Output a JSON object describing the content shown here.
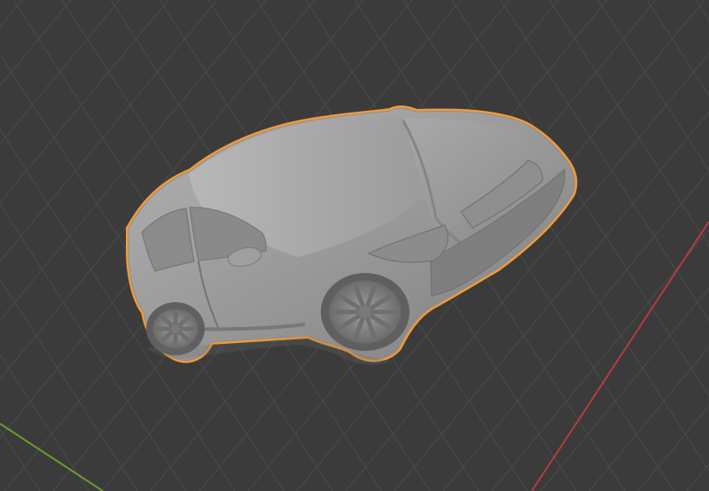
{
  "viewport": {
    "background_color": "#3b3b3b",
    "grid_color": "#4b4b4b",
    "x_axis_color": "#b53b43",
    "y_axis_color": "#6a9a2f",
    "selection_outline_color": "#f29a38"
  },
  "scene": {
    "object": "car-3d-model",
    "shading": "solid",
    "selected": true
  },
  "icons": {
    "car": "car-model-icon"
  }
}
